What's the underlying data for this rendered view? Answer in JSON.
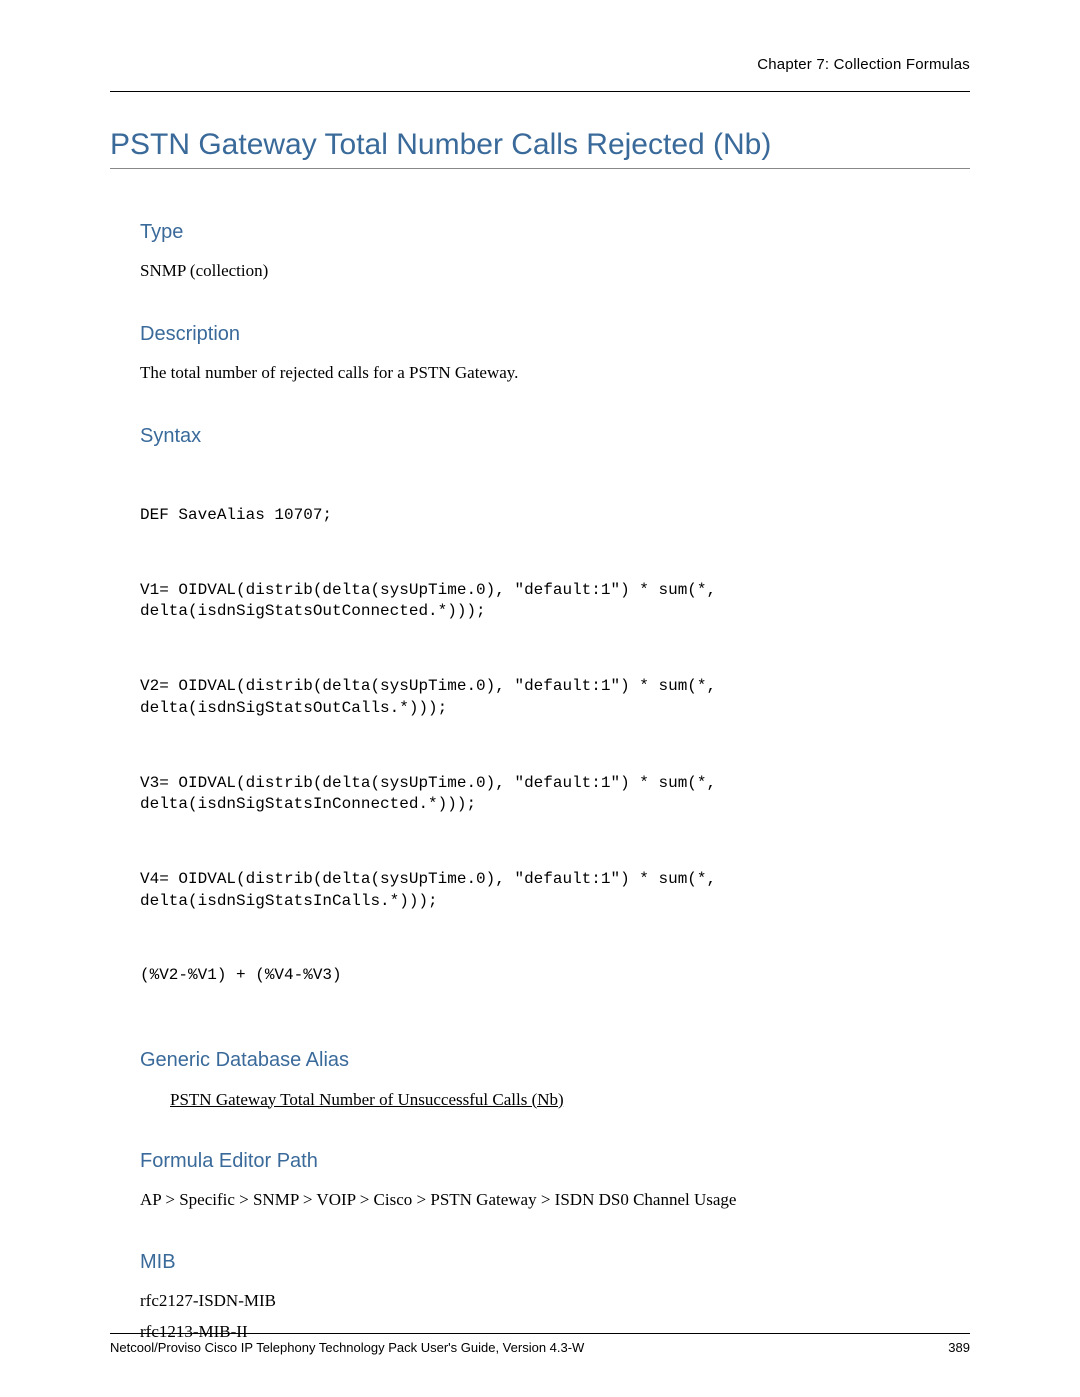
{
  "header": {
    "chapter": "Chapter 7: Collection Formulas"
  },
  "title": "PSTN Gateway Total Number Calls Rejected (Nb)",
  "sections": {
    "type": {
      "heading": "Type",
      "body": "SNMP (collection)"
    },
    "description": {
      "heading": "Description",
      "body": "The total number of rejected calls for a PSTN Gateway."
    },
    "syntax": {
      "heading": "Syntax",
      "lines": [
        "DEF SaveAlias 10707;",
        "V1= OIDVAL(distrib(delta(sysUpTime.0), \"default:1\") * sum(*,\ndelta(isdnSigStatsOutConnected.*)));",
        "V2= OIDVAL(distrib(delta(sysUpTime.0), \"default:1\") * sum(*,\ndelta(isdnSigStatsOutCalls.*)));",
        "V3= OIDVAL(distrib(delta(sysUpTime.0), \"default:1\") * sum(*,\ndelta(isdnSigStatsInConnected.*)));",
        "V4= OIDVAL(distrib(delta(sysUpTime.0), \"default:1\") * sum(*,\ndelta(isdnSigStatsInCalls.*)));",
        "(%V2-%V1) + (%V4-%V3)"
      ]
    },
    "alias": {
      "heading": "Generic Database Alias",
      "link": "PSTN Gateway Total Number of Unsuccessful Calls (Nb)"
    },
    "path": {
      "heading": "Formula Editor Path",
      "body": "AP > Specific > SNMP > VOIP > Cisco > PSTN Gateway > ISDN DS0 Channel Usage"
    },
    "mib": {
      "heading": "MIB",
      "lines": [
        "rfc2127-ISDN-MIB",
        "rfc1213-MIB-II"
      ]
    }
  },
  "footer": {
    "left": "Netcool/Proviso Cisco IP Telephony Technology Pack User's Guide, Version 4.3-W",
    "right": "389"
  }
}
